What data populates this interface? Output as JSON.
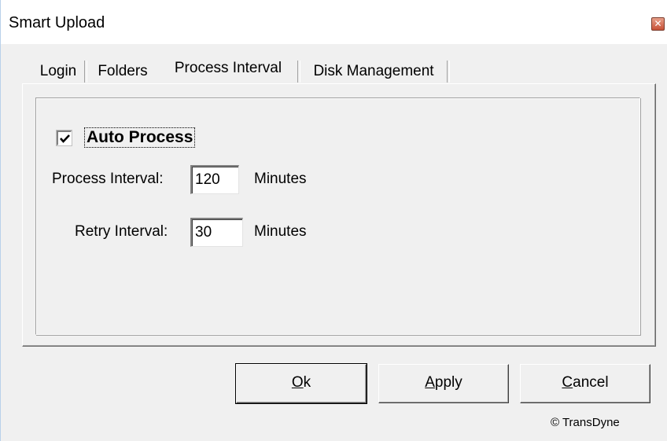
{
  "window": {
    "title": "Smart Upload",
    "close_glyph": "✕"
  },
  "tabs": [
    {
      "label": "Login"
    },
    {
      "label": "Folders"
    },
    {
      "label": "Process Interval",
      "active": true
    },
    {
      "label": "Disk Management"
    }
  ],
  "auto_process": {
    "label": "Auto Process",
    "checked": true
  },
  "process_interval": {
    "label": "Process  Interval:",
    "value": "120",
    "unit": "Minutes"
  },
  "retry_interval": {
    "label": "Retry Interval:",
    "value": "30",
    "unit": "Minutes"
  },
  "buttons": {
    "ok": {
      "mnemonic": "O",
      "rest": "k"
    },
    "apply": {
      "mnemonic": "A",
      "rest": "pply"
    },
    "cancel": {
      "mnemonic": "C",
      "rest": "ancel"
    }
  },
  "footer": {
    "copyright": "© TransDyne"
  }
}
